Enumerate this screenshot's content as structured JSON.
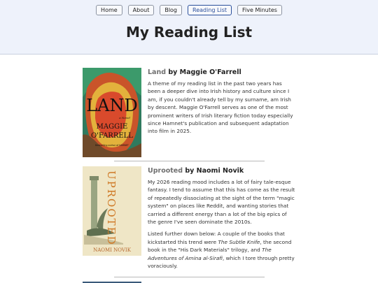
{
  "nav": {
    "items": [
      {
        "label": "Home"
      },
      {
        "label": "About"
      },
      {
        "label": "Blog"
      },
      {
        "label": "Reading List"
      },
      {
        "label": "Five Minutes"
      }
    ]
  },
  "page": {
    "title": "My Reading List"
  },
  "colors": {
    "header_bg": "#eef2fb",
    "active_nav": "#2a4f9c",
    "title_gray": "#707070"
  },
  "books": [
    {
      "title": "Land",
      "by": " by Maggie O'Farrell",
      "cover": {
        "title": "LAND",
        "subtitle": "a Novel",
        "author_line1": "MAGGIE",
        "author_line2": "O'FARRELL",
        "tagline": "Bestselling author of HAMNET"
      },
      "paragraphs": [
        "A theme of my reading list in the past two years has been a deeper dive into Irish history and culture since I am, if you couldn't already tell by my surname, am Irish by descent. Maggie O'Farrell serves as one of the most prominent writers of Irish literary fiction today especially since Hamnet's publication and subsequent adaptation into film in 2025."
      ]
    },
    {
      "title": "Uprooted",
      "by": " by Naomi Novik",
      "cover": {
        "title": "UPROOTED",
        "author": "NAOMI NOVIK"
      },
      "paragraphs": [
        "My 2026 reading mood includes a lot of fairy tale-esque fantasy. I tend to assume that this has come as the result of repeatedly dissociating at the sight of the term \"magic system\" on places like Reddit, and wanting stories that carried a different energy than a lot of the big epics of the genre I've seen dominate the 2010s."
      ],
      "para2": {
        "a": "Listed further down below: A couple of the books that kickstarted this trend were ",
        "b": "The Subtle Knife",
        "c": ", the second book in the \"His Dark Materials\" trilogy, and ",
        "d": "The Adventures of Amina al-Sirafi",
        "e": ", which I tore through pretty voraciously."
      }
    }
  ]
}
